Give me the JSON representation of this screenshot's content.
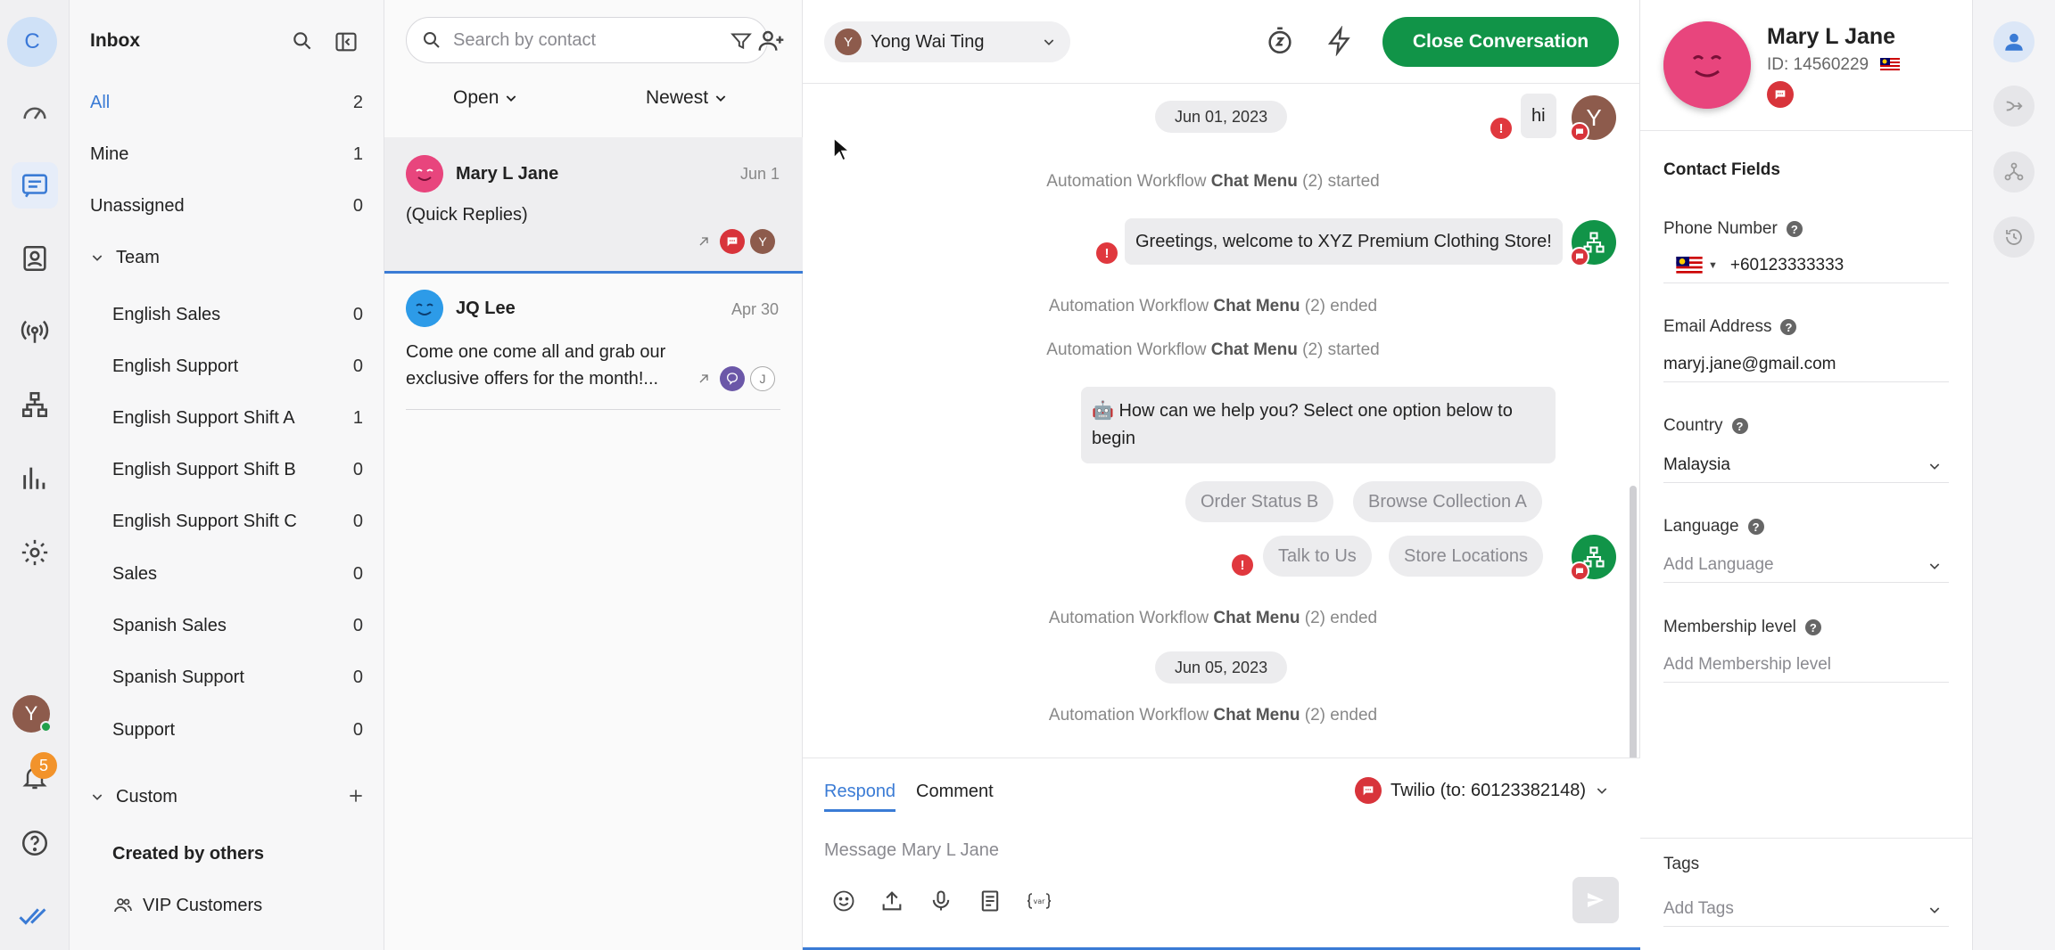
{
  "rail": {
    "org_initial": "C",
    "user_initial": "Y",
    "notifications": "5"
  },
  "inbox": {
    "title": "Inbox",
    "items": [
      {
        "label": "All",
        "count": "2"
      },
      {
        "label": "Mine",
        "count": "1"
      },
      {
        "label": "Unassigned",
        "count": "0"
      }
    ],
    "team_label": "Team",
    "teams": [
      {
        "label": "English Sales",
        "count": "0"
      },
      {
        "label": "English Support",
        "count": "0"
      },
      {
        "label": "English Support Shift A",
        "count": "1"
      },
      {
        "label": "English Support Shift B",
        "count": "0"
      },
      {
        "label": "English Support Shift C",
        "count": "0"
      },
      {
        "label": "Sales",
        "count": "0"
      },
      {
        "label": "Spanish Sales",
        "count": "0"
      },
      {
        "label": "Spanish Support",
        "count": "0"
      },
      {
        "label": "Support",
        "count": "0"
      }
    ],
    "custom_label": "Custom",
    "created_by_others": "Created by others",
    "vip": "VIP Customers"
  },
  "conversation_list": {
    "search_placeholder": "Search by contact",
    "status_filter": "Open",
    "sort": "Newest",
    "conversations": [
      {
        "name": "Mary L Jane",
        "date": "Jun 1",
        "preview": "(Quick Replies)",
        "assignee_initial": "Y"
      },
      {
        "name": "JQ Lee",
        "date": "Apr 30",
        "preview_line1": "Come one come all and grab our",
        "preview_line2": "exclusive offers for the month!...",
        "assignee_initial": "J"
      }
    ]
  },
  "chat": {
    "assignee": "Yong Wai Ting",
    "assignee_initial": "Y",
    "close_button": "Close Conversation",
    "messages": {
      "date1": "Jun 01, 2023",
      "hi": "hi",
      "sys1_pre": "Automation Workflow ",
      "sys1_b": "Chat Menu",
      "sys1_post": " (2) started",
      "greeting": "Greetings, welcome to XYZ Premium Clothing Store!",
      "sys2_pre": "Automation Workflow ",
      "sys2_b": "Chat Menu",
      "sys2_post": " (2) ended",
      "sys3_pre": "Automation Workflow ",
      "sys3_b": "Chat Menu",
      "sys3_post": " (2) started",
      "help_line1": "🤖 How can we help you? Select one option below to",
      "help_line2": "begin",
      "qr1": "Order Status B",
      "qr2": "Browse Collection A",
      "qr3": "Talk to Us",
      "qr4": "Store Locations",
      "sys4_pre": "Automation Workflow ",
      "sys4_b": "Chat Menu",
      "sys4_post": " (2) ended",
      "date2": "Jun 05, 2023",
      "sys5_pre": "Automation Workflow ",
      "sys5_b": "Chat Menu",
      "sys5_post": " (2) ended"
    },
    "composer": {
      "tab_respond": "Respond",
      "tab_comment": "Comment",
      "channel": "Twilio (to: 60123382148)",
      "placeholder": "Message Mary L Jane"
    }
  },
  "contact": {
    "name": "Mary L Jane",
    "id": "ID: 14560229",
    "section": "Contact Fields",
    "phone_label": "Phone Number",
    "phone": "+60123333333",
    "email_label": "Email Address",
    "email": "maryj.jane@gmail.com",
    "country_label": "Country",
    "country": "Malaysia",
    "language_label": "Language",
    "language_placeholder": "Add Language",
    "membership_label": "Membership level",
    "membership_placeholder": "Add Membership level",
    "tags_label": "Tags",
    "tags_placeholder": "Add Tags"
  },
  "colors": {
    "accent": "#3a7bd5",
    "primary_green": "#119448",
    "error_red": "#e0383e",
    "channel_red": "#d8343b"
  }
}
